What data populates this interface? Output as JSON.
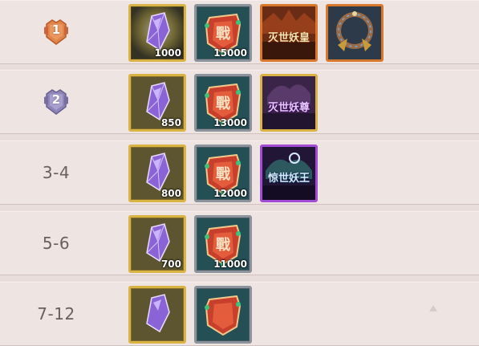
{
  "rows": [
    {
      "rank": "1",
      "rewards": [
        {
          "icon": "purple-crystal-icon",
          "count": "1000"
        },
        {
          "icon": "battle-token-icon",
          "count": "15000"
        },
        {
          "icon": "title-badge-icon",
          "text": "灭世妖皇"
        },
        {
          "icon": "ring-frame-icon"
        }
      ]
    },
    {
      "rank": "2",
      "rewards": [
        {
          "icon": "purple-crystal-icon",
          "count": "850"
        },
        {
          "icon": "battle-token-icon",
          "count": "13000"
        },
        {
          "icon": "title-badge-icon",
          "text": "灭世妖尊"
        }
      ]
    },
    {
      "rank": "3-4",
      "rewards": [
        {
          "icon": "purple-crystal-icon",
          "count": "800"
        },
        {
          "icon": "battle-token-icon",
          "count": "12000"
        },
        {
          "icon": "title-badge-icon",
          "text": "惊世妖王"
        }
      ]
    },
    {
      "rank": "5-6",
      "rewards": [
        {
          "icon": "purple-crystal-icon",
          "count": "700"
        },
        {
          "icon": "battle-token-icon",
          "count": "11000"
        }
      ]
    },
    {
      "rank": "7-12",
      "rewards": [
        {
          "icon": "purple-crystal-icon"
        },
        {
          "icon": "battle-token-icon"
        }
      ]
    }
  ],
  "colors": {
    "row_bg": "#eee4e2",
    "medal_gold": "#e0844a",
    "medal_silver": "#8f86b8",
    "frame_gold": "#d9b344",
    "frame_silver": "#8b949c",
    "frame_orange": "#d7782d",
    "frame_purple": "#a24bd4"
  }
}
